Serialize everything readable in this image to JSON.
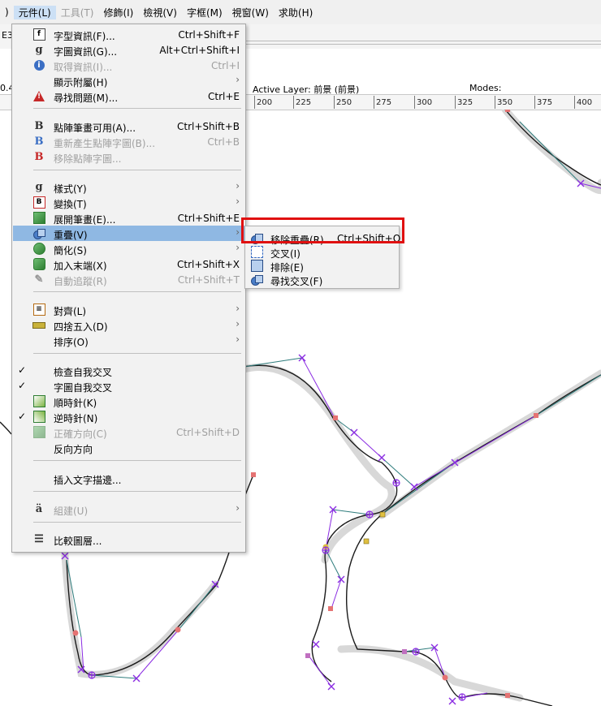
{
  "menubar": {
    "items": [
      {
        "label": ")",
        "disabled": false
      },
      {
        "label": "元件(L)",
        "disabled": false,
        "open": true
      },
      {
        "label": "工具(T)",
        "disabled": true
      },
      {
        "label": "修飾(I)",
        "disabled": false
      },
      {
        "label": "檢視(V)",
        "disabled": false
      },
      {
        "label": "字框(M)",
        "disabled": false
      },
      {
        "label": "視窗(W)",
        "disabled": false
      },
      {
        "label": "求助(H)",
        "disabled": false
      }
    ]
  },
  "toolbar": {
    "left_text": "E3"
  },
  "info": {
    "left_text": "0.4"
  },
  "status": {
    "active_layer": "Active Layer: 前景 (前景)",
    "modes": "Modes:"
  },
  "ruler": {
    "ticks": [
      "200",
      "225",
      "250",
      "275",
      "300",
      "325",
      "350",
      "375",
      "400"
    ]
  },
  "element_menu": {
    "items": [
      {
        "label": "字型資訊(F)...",
        "shortcut": "Ctrl+Shift+F",
        "icon": "font-info-icon"
      },
      {
        "label": "字圖資訊(G)...",
        "shortcut": "Alt+Ctrl+Shift+I",
        "icon": "glyph-info-icon"
      },
      {
        "label": "取得資訊(I)...",
        "shortcut": "Ctrl+I",
        "icon": "info-icon",
        "disabled": true
      },
      {
        "label": "顯示附屬(H)",
        "submenu": true
      },
      {
        "label": "尋找問題(M)...",
        "shortcut": "Ctrl+E",
        "icon": "warning-icon"
      },
      {
        "label": "點陣筆畫可用(A)...",
        "shortcut": "Ctrl+Shift+B",
        "icon": "bitmap-icon"
      },
      {
        "label": "重新產生點陣字圖(B)...",
        "shortcut": "Ctrl+B",
        "icon": "regen-bitmap-icon",
        "disabled": true
      },
      {
        "label": "移除點陣字圖...",
        "icon": "remove-bitmap-icon",
        "disabled": true
      },
      {
        "label": "樣式(Y)",
        "submenu": true,
        "icon": "style-icon"
      },
      {
        "label": "變換(T)",
        "submenu": true,
        "icon": "transform-icon"
      },
      {
        "label": "展開筆畫(E)...",
        "shortcut": "Ctrl+Shift+E",
        "icon": "expand-stroke-icon"
      },
      {
        "label": "重疊(V)",
        "submenu": true,
        "icon": "overlap-icon",
        "highlight": true
      },
      {
        "label": "簡化(S)",
        "submenu": true,
        "icon": "simplify-icon"
      },
      {
        "label": "加入末端(X)",
        "shortcut": "Ctrl+Shift+X",
        "icon": "add-extrema-icon"
      },
      {
        "label": "自動追蹤(R)",
        "shortcut": "Ctrl+Shift+T",
        "icon": "autotrace-icon",
        "disabled": true
      },
      {
        "label": "對齊(L)",
        "submenu": true,
        "icon": "align-icon"
      },
      {
        "label": "四捨五入(D)",
        "submenu": true,
        "icon": "round-icon"
      },
      {
        "label": "排序(O)",
        "submenu": true
      },
      {
        "label": "檢查自我交叉",
        "checked": true
      },
      {
        "label": "字圖自我交叉",
        "checked": true
      },
      {
        "label": "順時針(K)",
        "icon": "clockwise-icon"
      },
      {
        "label": "逆時針(N)",
        "icon": "counterclockwise-icon",
        "checked": true
      },
      {
        "label": "正確方向(C)",
        "shortcut": "Ctrl+Shift+D",
        "icon": "correct-direction-icon",
        "disabled": true
      },
      {
        "label": "反向方向"
      },
      {
        "label": "插入文字描邊..."
      },
      {
        "label": "組建(U)",
        "submenu": true,
        "icon": "build-icon",
        "disabled": true
      },
      {
        "label": "比較圖層...",
        "icon": "compare-layers-icon"
      }
    ]
  },
  "overlap_submenu": {
    "items": [
      {
        "label": "移除重疊(R)",
        "shortcut": "Ctrl+Shift+O",
        "icon": "remove-overlap-icon"
      },
      {
        "label": "交叉(I)",
        "icon": "intersect-icon"
      },
      {
        "label": "排除(E)",
        "icon": "exclude-icon"
      },
      {
        "label": "尋找交叉(F)",
        "icon": "find-intersections-icon"
      }
    ]
  },
  "colors": {
    "menu_highlight": "#8fb8e3",
    "annotation_box": "#e01010",
    "path": "#1a1a1a",
    "control_line": "#2f7d7d",
    "control_point": "#8a2be2",
    "on_curve_point": "#e57373"
  }
}
